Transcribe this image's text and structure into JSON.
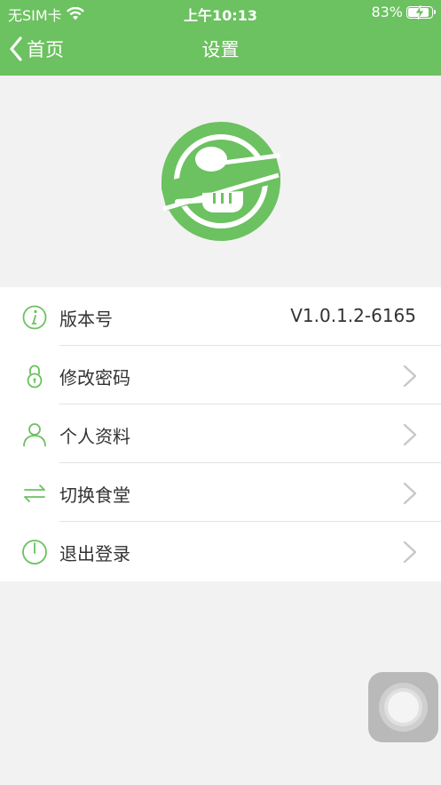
{
  "status_bar": {
    "carrier": "无SIM卡",
    "time": "上午10:13",
    "battery_percent": "83%",
    "battery_level": 0.83,
    "icons": [
      "wifi-icon",
      "battery-charging-icon"
    ]
  },
  "nav": {
    "back_label": "首页",
    "title": "设置",
    "color": "#6cc160"
  },
  "logo": {
    "icon": "spoon-fork-logo",
    "color": "#6cc160"
  },
  "menu": {
    "items": [
      {
        "icon": "info-icon",
        "label": "版本号",
        "value": "V1.0.1.2-6165"
      },
      {
        "icon": "lock-icon",
        "label": "修改密码"
      },
      {
        "icon": "user-icon",
        "label": "个人资料"
      },
      {
        "icon": "swap-icon",
        "label": "切换食堂"
      },
      {
        "icon": "power-icon",
        "label": "退出登录"
      }
    ]
  }
}
